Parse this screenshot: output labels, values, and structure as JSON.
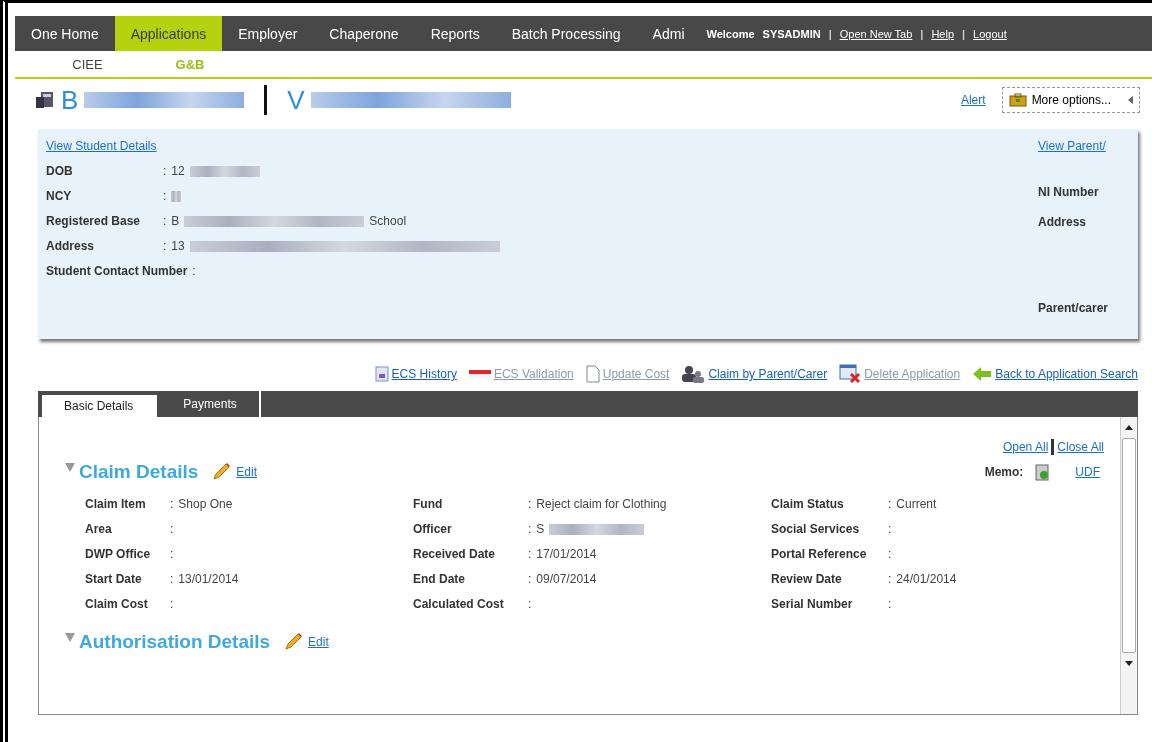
{
  "nav": {
    "items": [
      {
        "label": "One Home",
        "selected": false
      },
      {
        "label": "Applications",
        "selected": true
      },
      {
        "label": "Employer",
        "selected": false
      },
      {
        "label": "Chaperone",
        "selected": false
      },
      {
        "label": "Reports",
        "selected": false
      },
      {
        "label": "Batch Processing",
        "selected": false
      },
      {
        "label": "Admi",
        "selected": false
      }
    ],
    "welcome": "Welcome",
    "user": "SYSADMIN",
    "separator": "|",
    "links": [
      "Open New Tab",
      "Help",
      "Logout"
    ]
  },
  "subnav": [
    {
      "label": "CIEE",
      "selected": false
    },
    {
      "label": "G&B",
      "selected": true
    }
  ],
  "header": {
    "student_name": "B",
    "parent_name": "V",
    "alert": "Alert",
    "more_options": "More options..."
  },
  "colon": ":",
  "student": {
    "link": "View Student Details",
    "fields": [
      {
        "label": "DOB",
        "value": "12",
        "redacted": true
      },
      {
        "label": "NCY",
        "redacted": true
      },
      {
        "label": "Registered Base",
        "value": "B",
        "redacted": true,
        "value_after": "School"
      },
      {
        "label": "Address",
        "value": "13",
        "redacted": true
      },
      {
        "label": "Student Contact Number"
      }
    ],
    "parent_link": "View Parent/",
    "parent_fields": [
      "NI Number",
      "Address",
      "Parent/carer"
    ]
  },
  "actions": [
    {
      "label": "ECS History",
      "kind": "history",
      "disabled": false
    },
    {
      "label": "ECS Validation",
      "kind": "validation",
      "disabled": true
    },
    {
      "label": "Update Cost",
      "kind": "document",
      "disabled": true
    },
    {
      "label": "Claim by Parent/Carer",
      "kind": "people",
      "disabled": false
    },
    {
      "label": "Delete Application",
      "kind": "delete",
      "disabled": true
    },
    {
      "label": "Back to Application Search",
      "kind": "back",
      "disabled": false
    }
  ],
  "tabs": [
    {
      "label": "Basic Details",
      "selected": true
    },
    {
      "label": "Payments",
      "selected": false
    }
  ],
  "open_all": "Open All",
  "close_all": "Close All",
  "memo": "Memo:",
  "udf": "UDF",
  "sections": [
    {
      "title": "Claim Details",
      "expanded": true,
      "edit": "Edit",
      "columns": [
        [
          {
            "label": "Claim Item",
            "value": "Shop One"
          },
          {
            "label": "Area"
          },
          {
            "label": "DWP Office"
          },
          {
            "label": "Start Date",
            "value": "13/01/2014"
          },
          {
            "label": "Claim Cost"
          }
        ],
        [
          {
            "label": "Fund",
            "value": "Reject claim for Clothing"
          },
          {
            "label": "Officer",
            "value": "S",
            "redacted": true
          },
          {
            "label": "Received Date",
            "value": "17/01/2014"
          },
          {
            "label": "End Date",
            "value": "09/07/2014"
          },
          {
            "label": "Calculated Cost"
          }
        ],
        [
          {
            "label": "Claim Status",
            "value": "Current"
          },
          {
            "label": "Social Services"
          },
          {
            "label": "Portal Reference"
          },
          {
            "label": "Review Date",
            "value": "24/01/2014"
          },
          {
            "label": "Serial Number"
          }
        ]
      ]
    },
    {
      "title": "Authorisation Details",
      "expanded": true,
      "edit": "Edit"
    }
  ]
}
